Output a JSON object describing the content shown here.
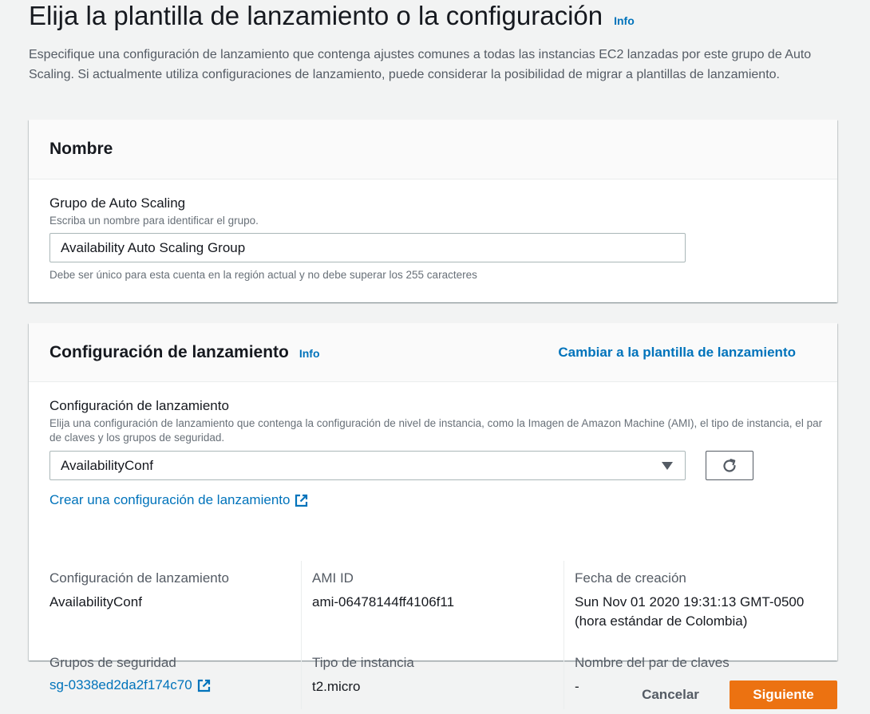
{
  "page": {
    "title": "Elija la plantilla de lanzamiento o la configuración",
    "info_label": "Info",
    "description": "Especifique una configuración de lanzamiento que contenga ajustes comunes a todas las instancias EC2 lanzadas por este grupo de Auto Scaling. Si actualmente utiliza configuraciones de lanzamiento, puede considerar la posibilidad de migrar a plantillas de lanzamiento."
  },
  "name_panel": {
    "title": "Nombre",
    "field_label": "Grupo de Auto Scaling",
    "field_description": "Escriba un nombre para identificar el grupo.",
    "input_value": "Availability Auto Scaling Group",
    "constraint": "Debe ser único para esta cuenta en la región actual y no debe superar los 255 caracteres"
  },
  "launch_panel": {
    "title": "Configuración de lanzamiento",
    "info_label": "Info",
    "switch_link": "Cambiar a la plantilla de lanzamiento",
    "field_label": "Configuración de lanzamiento",
    "field_description": "Elija una configuración de lanzamiento que contenga la configuración de nivel de instancia, como la Imagen de Amazon Machine (AMI), el tipo de instancia, el par de claves y los grupos de seguridad.",
    "selected_value": "AvailabilityConf",
    "create_link": "Crear una configuración de lanzamiento",
    "details": {
      "launch_config_label": "Configuración de lanzamiento",
      "launch_config_value": "AvailabilityConf",
      "ami_label": "AMI ID",
      "ami_value": "ami-06478144ff4106f11",
      "created_label": "Fecha de creación",
      "created_value_line1": "Sun Nov 01 2020 19:31:13 GMT-0500",
      "created_value_line2": "(hora estándar de Colombia)",
      "security_groups_label": "Grupos de seguridad",
      "security_groups_value": "sg-0338ed2da2f174c70",
      "instance_type_label": "Tipo de instancia",
      "instance_type_value": "t2.micro",
      "key_pair_label": "Nombre del par de claves",
      "key_pair_value": "-"
    }
  },
  "footer": {
    "cancel_label": "Cancelar",
    "next_label": "Siguiente"
  },
  "colors": {
    "link": "#0073bb",
    "primary_button": "#ec7211",
    "background": "#f2f3f3"
  },
  "icons": {
    "external_link": "external-link-icon",
    "refresh": "refresh-icon",
    "dropdown": "caret-down-icon"
  }
}
